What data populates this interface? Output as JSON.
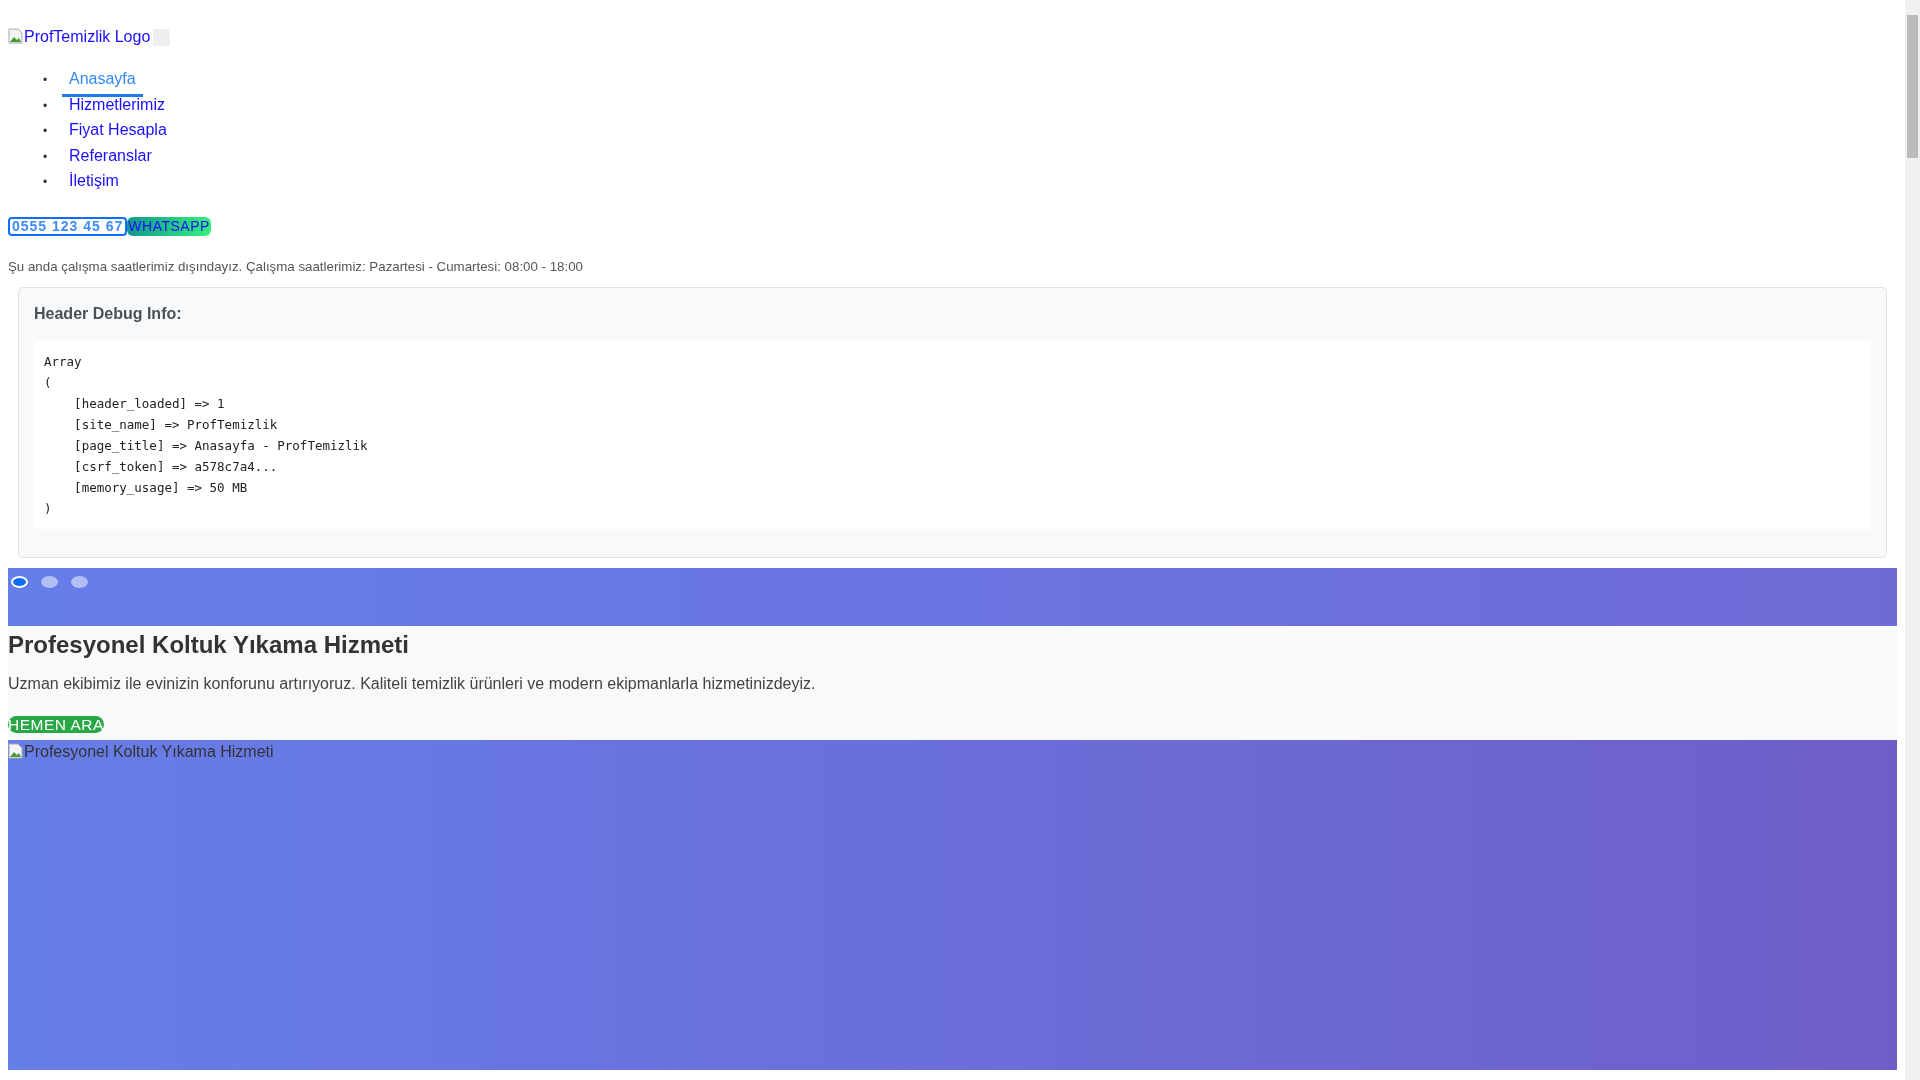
{
  "logo": {
    "alt": "ProfTemizlik Logo"
  },
  "nav": [
    {
      "bullet": "•",
      "label": "Anasayfa",
      "selected": true
    },
    {
      "bullet": "•",
      "label": "Hizmetlerimiz",
      "selected": false
    },
    {
      "bullet": "•",
      "label": "Fiyat Hesapla",
      "selected": false
    },
    {
      "bullet": "•",
      "label": "Referanslar",
      "selected": false
    },
    {
      "bullet": "•",
      "label": "İletişim",
      "selected": false
    }
  ],
  "contact": {
    "phone": "0555 123 45 67",
    "whatsapp": "WHATSAPP"
  },
  "notice": "Şu anda çalışma saatlerimiz dışındayız. Çalışma saatlerimiz: Pazartesi - Cumartesi: 08:00 - 18:00",
  "debug": {
    "title": "Header Debug Info:",
    "lines": [
      "Array",
      "(",
      "    [header_loaded] => 1",
      "    [site_name] => ProfTemizlik",
      "    [page_title] => Anasayfa - ProfTemizlik",
      "    [csrf_token] => a578c7a4...",
      "    [memory_usage] => 50 MB",
      ")"
    ]
  },
  "slider": {
    "dots": [
      {
        "selected": true
      },
      {
        "selected": false
      },
      {
        "selected": false
      }
    ]
  },
  "hero": {
    "title": "Profesyonel Koltuk Yıkama Hizmeti",
    "text": "Uzman ekibimiz ile evinizin konforunu artırıyoruz. Kaliteli temizlik ürünleri ve modern ekipmanlarla hizmetinizdeyiz.",
    "button": "HEMEN ARA",
    "image_alt": "Profesyonel Koltuk Yıkama Hizmeti"
  }
}
